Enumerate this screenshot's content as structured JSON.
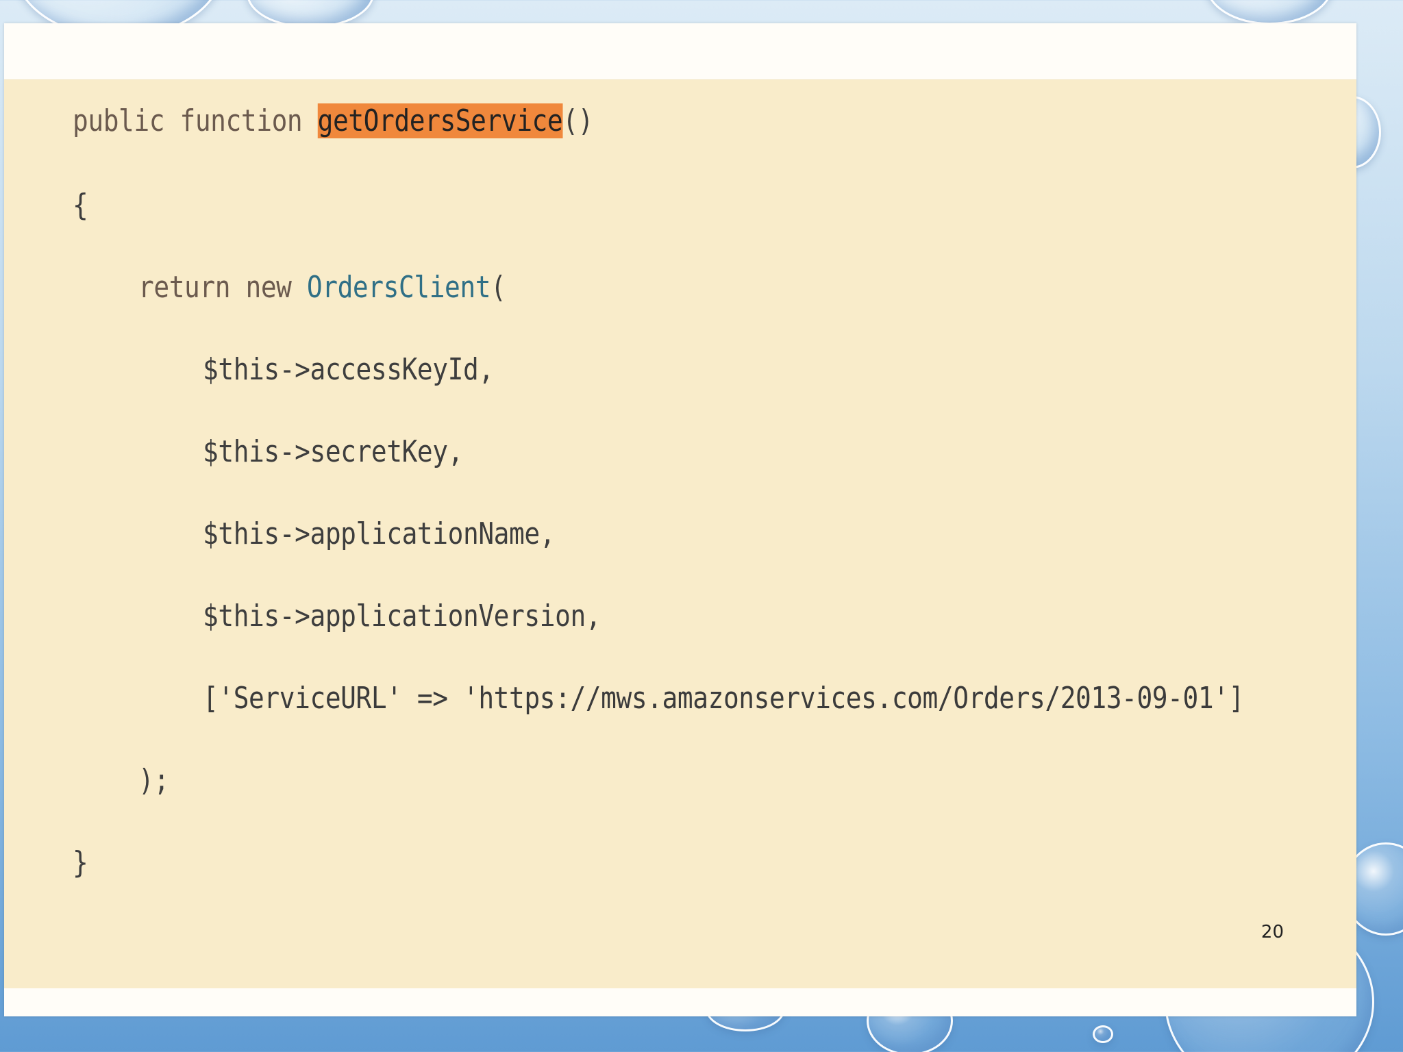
{
  "code": {
    "line1": {
      "prefix": "public function ",
      "highlight": "getOrdersService",
      "suffix": "()"
    },
    "line2": "{",
    "line3": {
      "keyword": "return new ",
      "class_name": "OrdersClient",
      "suffix": "("
    },
    "line4": "$this->accessKeyId,",
    "line5": "$this->secretKey,",
    "line6": "$this->applicationName,",
    "line7": "$this->applicationVersion,",
    "line8": "['ServiceURL' => 'https://mws.amazonservices.com/Orders/2013-09-01']",
    "line9": ");",
    "line10": "}"
  },
  "page_number": "20",
  "colors": {
    "highlight": "#f0883c",
    "code_background": "#f9ecca",
    "class_name": "#2f6f86"
  }
}
